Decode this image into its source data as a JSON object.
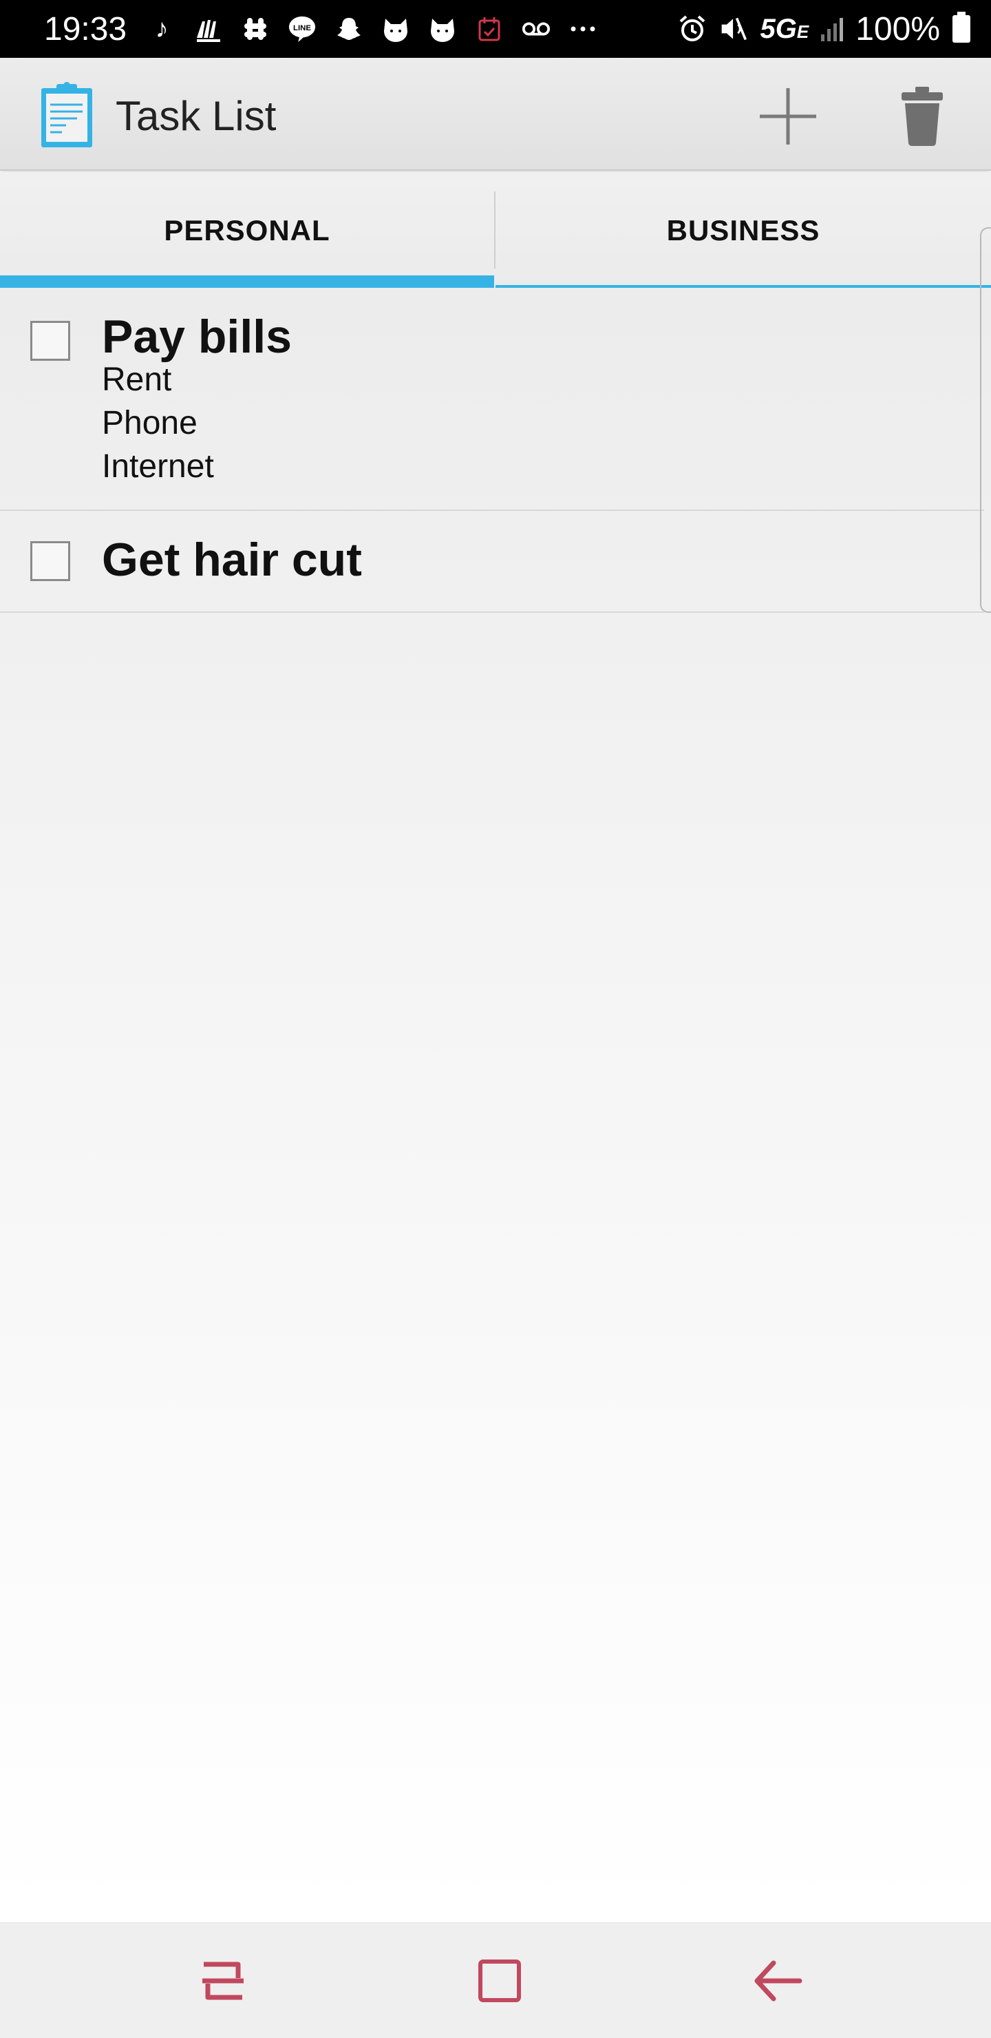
{
  "status_bar": {
    "time": "19:33",
    "network": "5G",
    "network_sub": "E",
    "battery": "100%"
  },
  "app_bar": {
    "title": "Task List",
    "icon": "clipboard-icon",
    "actions": [
      "add-icon",
      "trash-icon"
    ]
  },
  "tabs": [
    {
      "label": "PERSONAL",
      "selected": true
    },
    {
      "label": "BUSINESS",
      "selected": false
    }
  ],
  "tasks": [
    {
      "title": "Pay bills",
      "checked": false,
      "items": [
        "Rent",
        "Phone",
        "Internet"
      ]
    },
    {
      "title": "Get hair cut",
      "checked": false,
      "items": []
    }
  ],
  "colors": {
    "accent": "#35b3e5",
    "nav_icons": "#c0485f"
  }
}
